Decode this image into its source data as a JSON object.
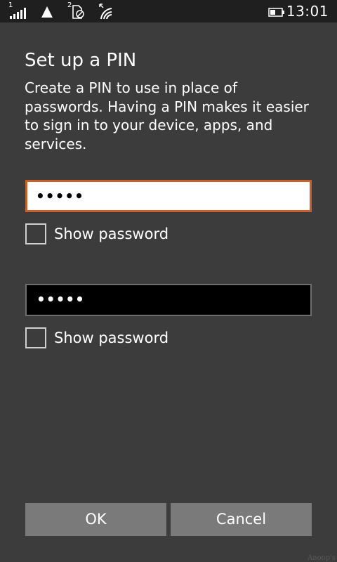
{
  "status_bar": {
    "sim1_label": "1",
    "sim2_label": "2",
    "time": "13:01",
    "icons": [
      "signal-strength-icon",
      "no-signal-triangle-icon",
      "sim2-no-sim-icon",
      "wifi-icon",
      "battery-icon"
    ]
  },
  "dialog": {
    "title": "Set up a PIN",
    "description": "Create a PIN to use in place of passwords. Having a PIN makes it easier to sign in to your device, apps, and services.",
    "pin_field": {
      "value": "•••••"
    },
    "confirm_pin_field": {
      "value": "•••••"
    },
    "show_password_label_1": "Show password",
    "show_password_label_2": "Show password",
    "ok_label": "OK",
    "cancel_label": "Cancel"
  },
  "watermark": "Anoop's",
  "colors": {
    "background": "#3c3c3c",
    "status_bar": "#1f1f1f",
    "accent_focus_border": "#c8602a",
    "button": "#7a7a7a"
  }
}
